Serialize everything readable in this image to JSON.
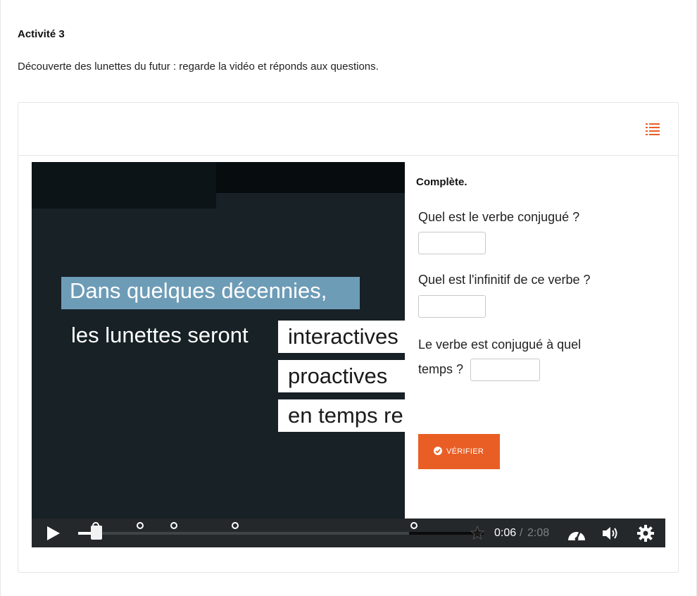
{
  "activity": {
    "title": "Activité 3",
    "description": "Découverte des lunettes du futur : regarde la vidéo et réponds aux questions."
  },
  "header": {
    "bookmarks_icon": "bookmarks-list-icon",
    "accent_color": "#e95e24"
  },
  "video": {
    "line1": "Dans quelques décennies,",
    "line2": "les lunettes seront",
    "words": [
      "interactives",
      "proactives",
      "en temps re"
    ],
    "highlight_color": "#6d9cb7",
    "background_color": "#172126"
  },
  "interaction": {
    "instruction": "Complète.",
    "questions": [
      {
        "text": "Quel est le verbe conjugué ?",
        "value": ""
      },
      {
        "text": "Quel est l'infinitif de ce verbe ?",
        "value": ""
      },
      {
        "text_line1": "Le verbe est conjugué à quel",
        "text_line2": "temps ?",
        "value": ""
      }
    ],
    "verify_label": "VÉRIFIER",
    "verify_color": "#e95e24"
  },
  "player": {
    "current_time": "0:06",
    "separator": "/",
    "total_time": "2:08",
    "progress_fraction": 0.047,
    "icons": [
      "play-icon",
      "speed-icon",
      "volume-icon",
      "settings-gear-icon"
    ]
  }
}
